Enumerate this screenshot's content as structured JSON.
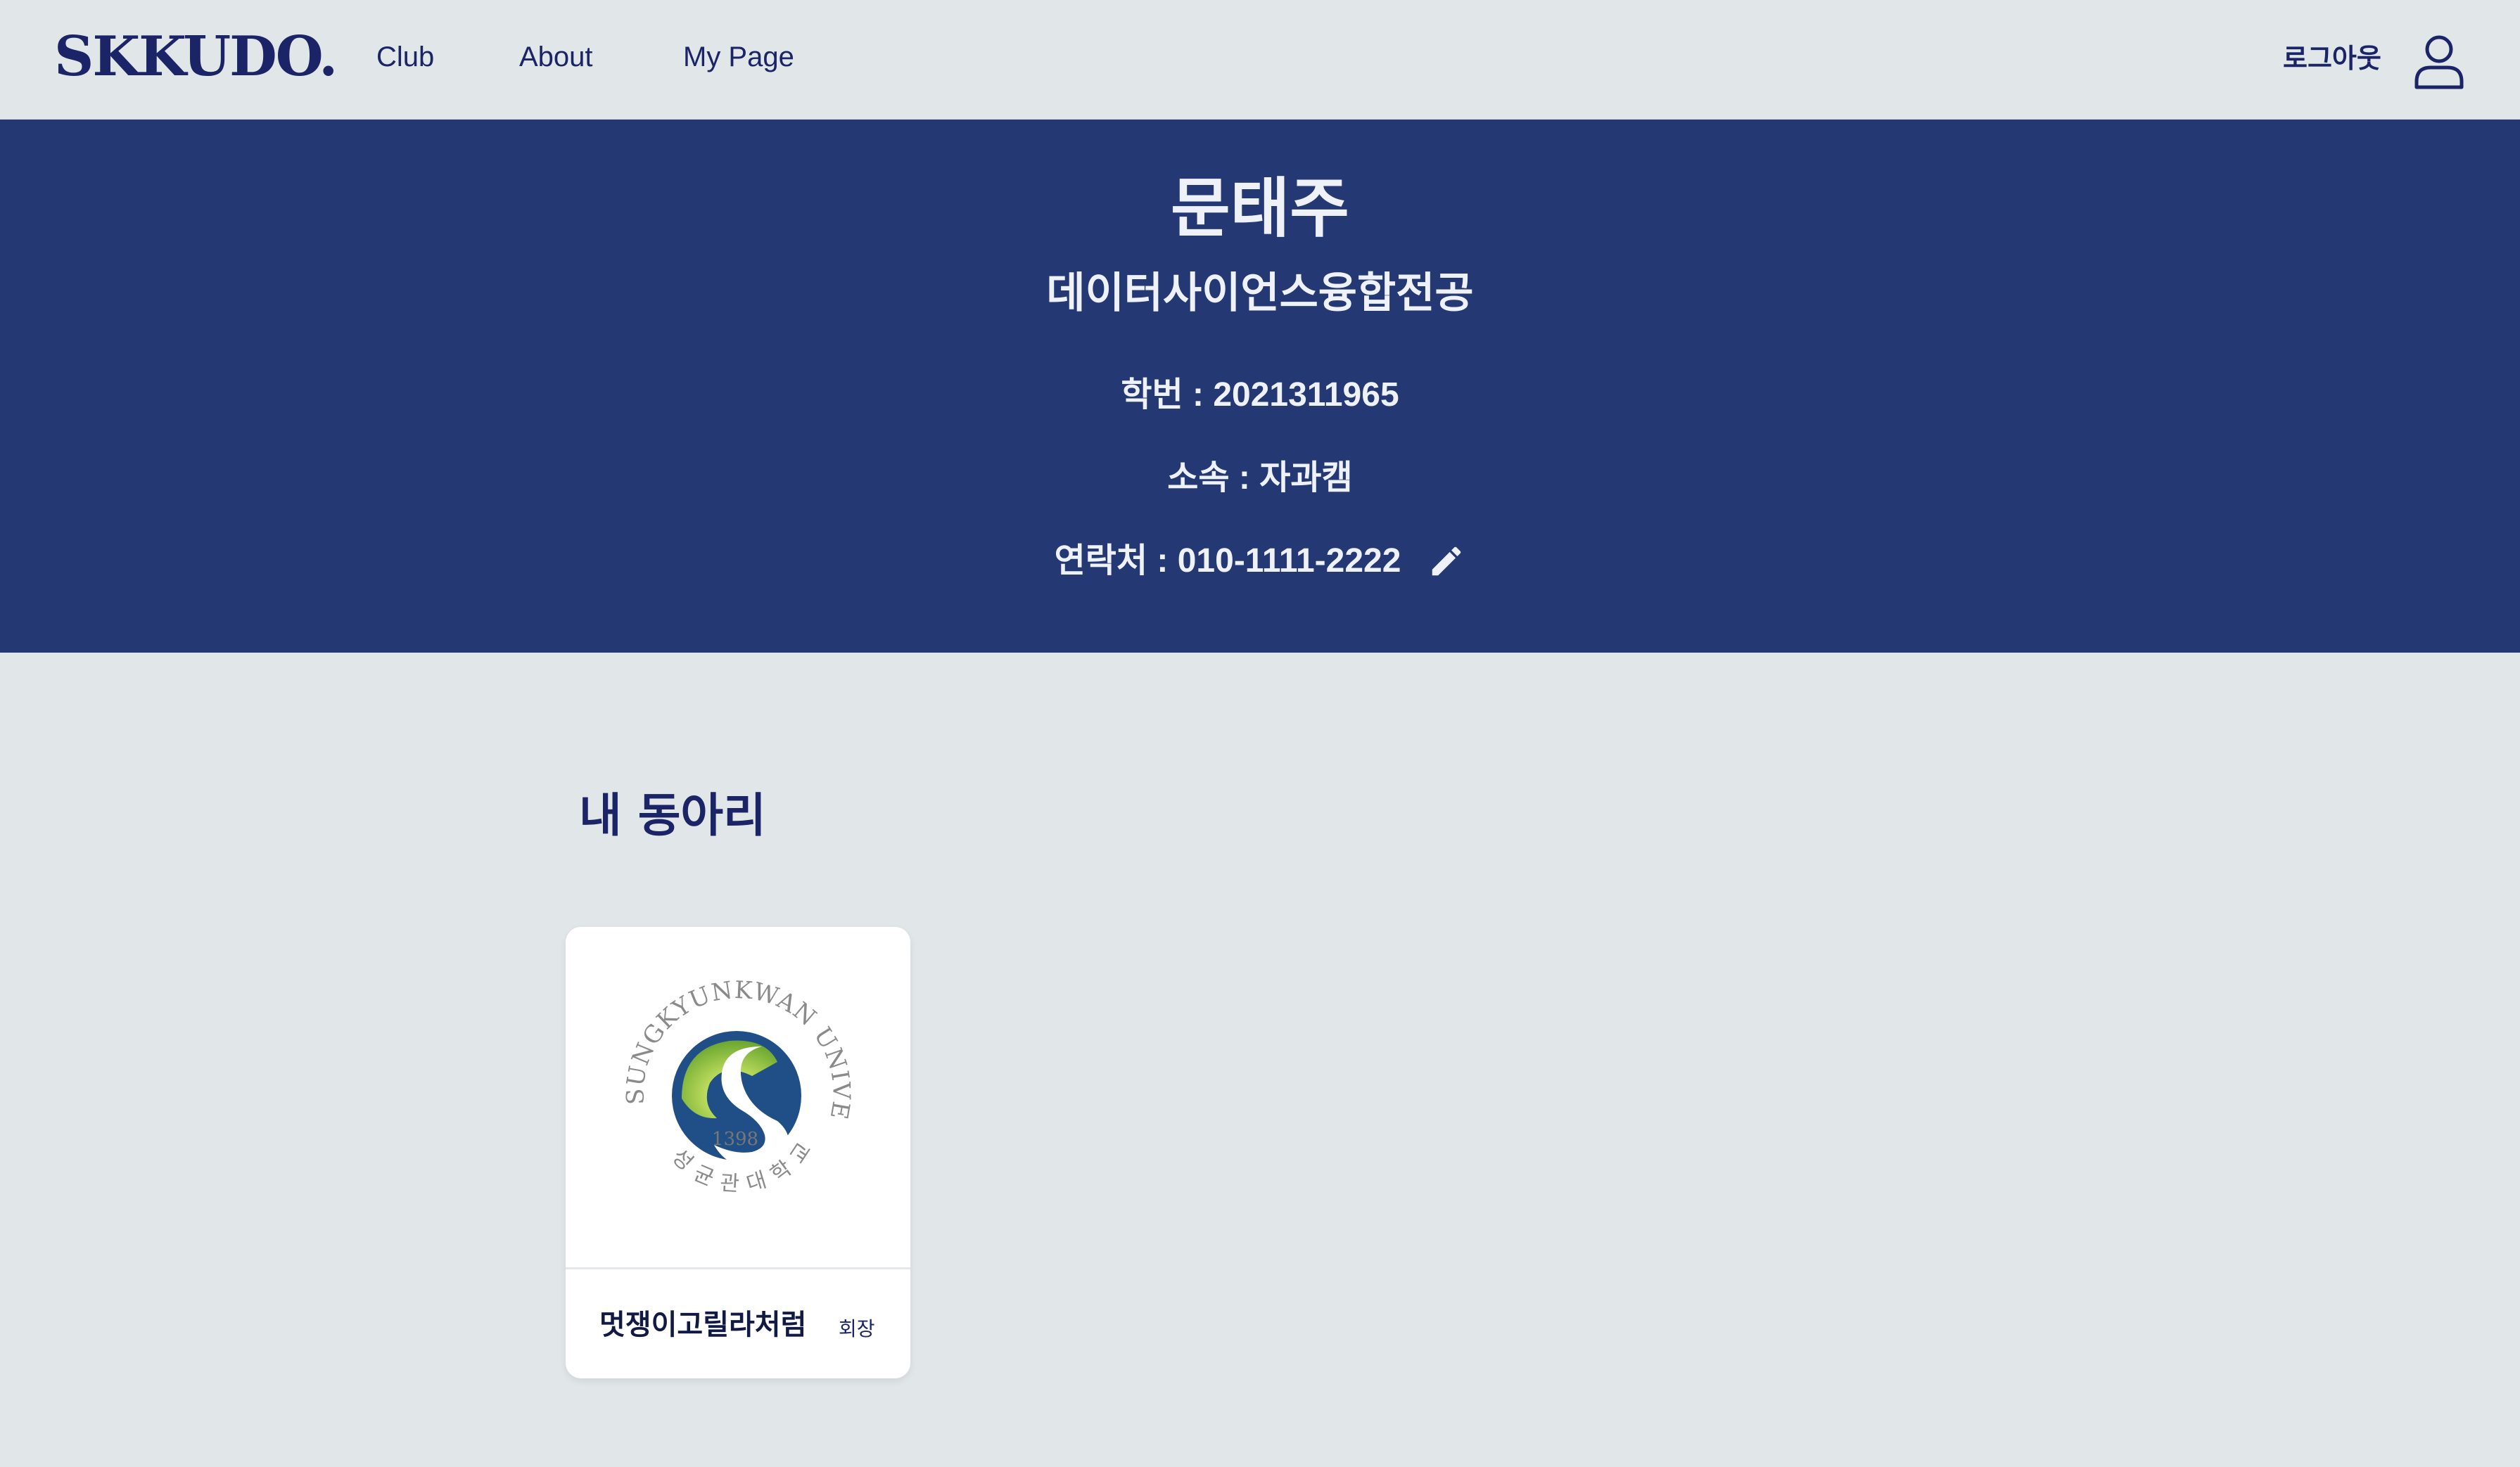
{
  "header": {
    "logo": "SKKUDO.",
    "nav": {
      "club": "Club",
      "about": "About",
      "mypage": "My Page"
    },
    "logout_label": "로그아웃",
    "user_icon": "user-icon"
  },
  "profile": {
    "name": "문태주",
    "major": "데이터사이언스융합전공",
    "student_id_label": "학번 : 2021311965",
    "campus_label": "소속 : 자과캠",
    "contact_label": "연락처 : 010-1111-2222",
    "edit_icon": "pencil-icon"
  },
  "my_clubs": {
    "title": "내 동아리",
    "items": [
      {
        "name": "멋쟁이고릴라처럼",
        "role": "회장",
        "logo": "university-seal-image",
        "logo_text": {
          "ring_en": "SUNGKYUNKWAN UNIVERSITY",
          "ring_ko": "성균관대학교",
          "year": "1398"
        }
      }
    ]
  },
  "colors": {
    "navy": "#1a2466",
    "hero_bg": "#243874",
    "page_bg": "#e1e6e9",
    "seal_blue": "#1f4f86",
    "seal_green": "#8cc63f"
  }
}
